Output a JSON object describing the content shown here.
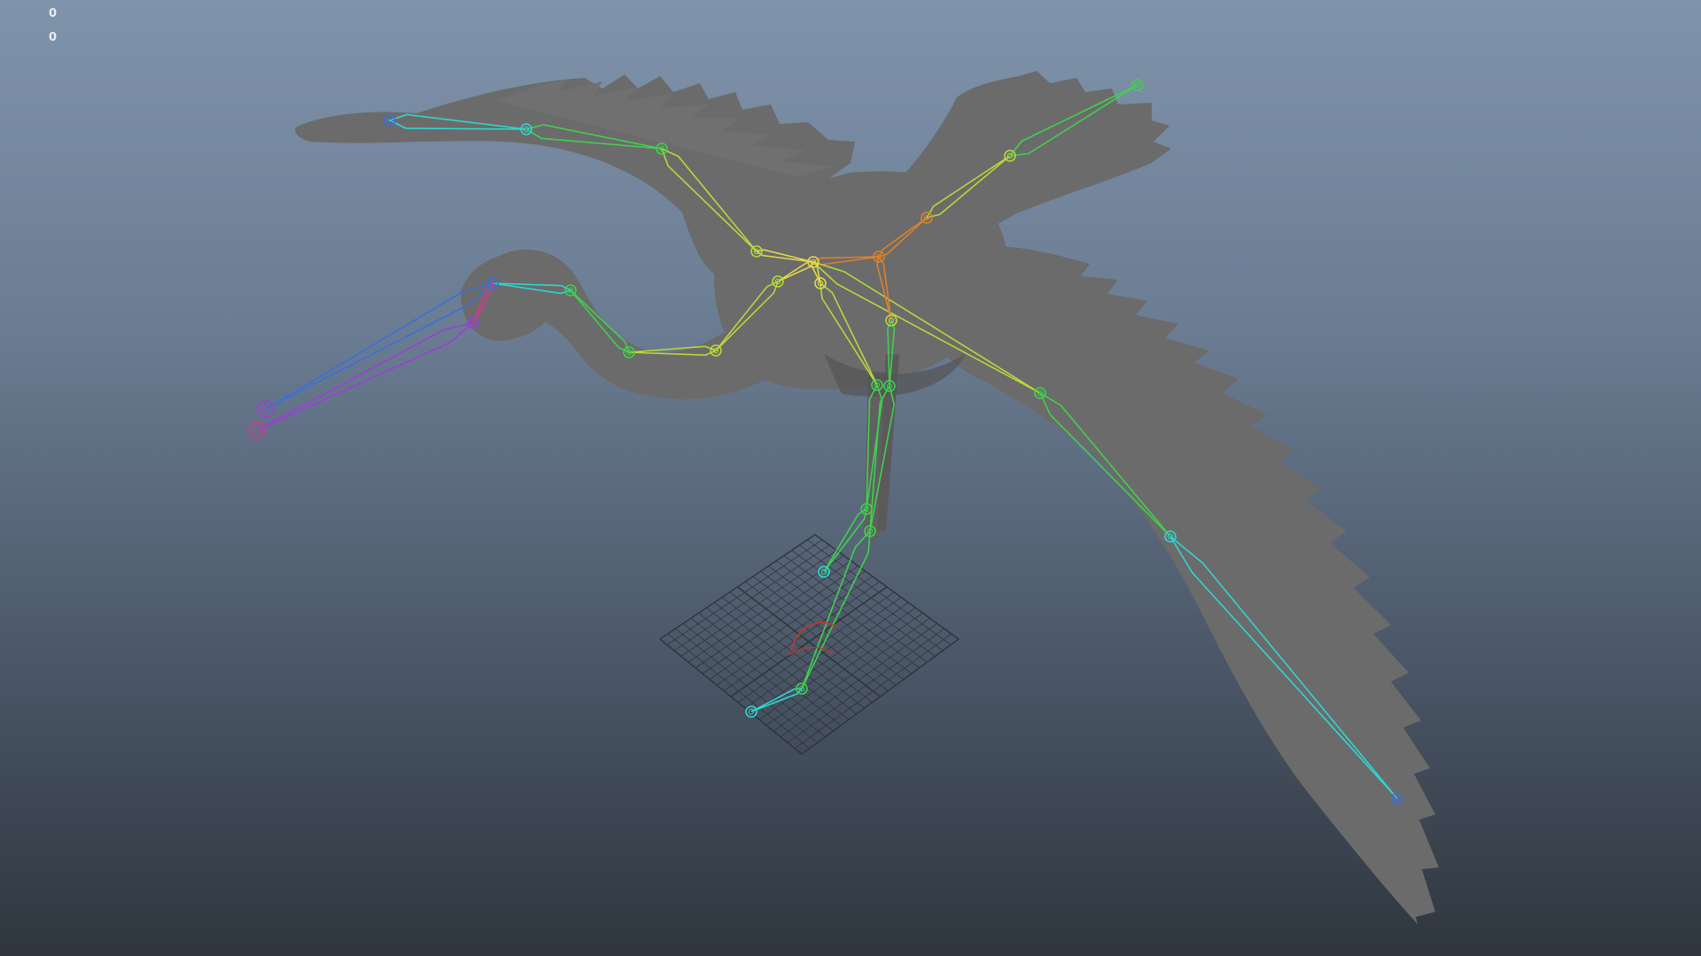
{
  "hud": {
    "counters": [
      "0",
      "0"
    ]
  },
  "viewport": {
    "background_top": "#7f93ab",
    "background_bottom": "#2f363f"
  },
  "model": {
    "mesh_color": "#6b6b6b",
    "mesh_shadow": "#545454"
  },
  "rig": {
    "colors": {
      "cyan": "#2fd6d0",
      "green": "#3fd14e",
      "yellow_green": "#b6d83a",
      "yellow": "#e3d84a",
      "orange": "#d9822e",
      "blue": "#3c6fd8",
      "purple": "#9b3fd6",
      "magenta": "#d03a8e",
      "red": "#c8352a",
      "grid": "#2c2f33"
    }
  }
}
